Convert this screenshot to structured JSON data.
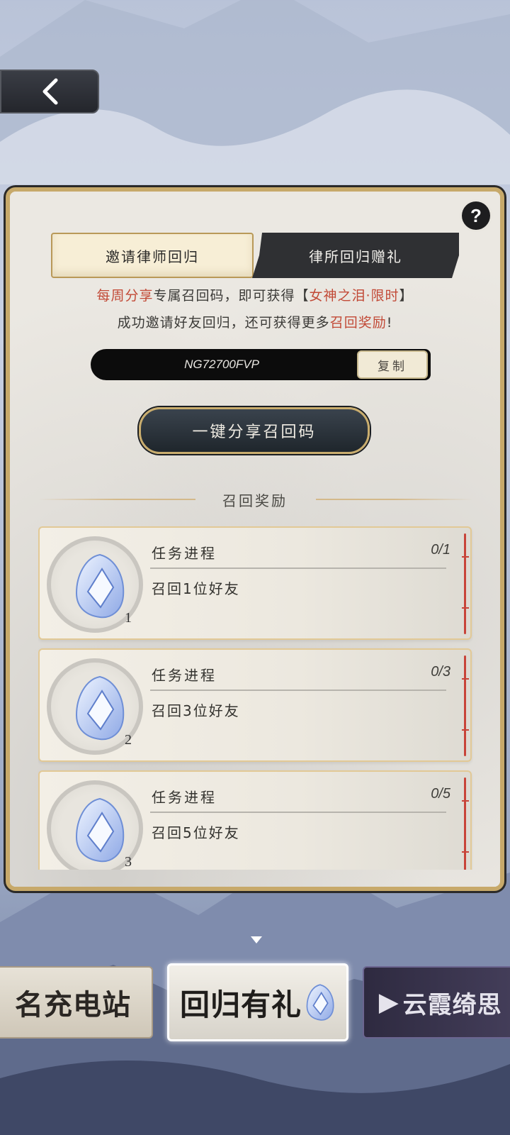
{
  "tabs": [
    {
      "label": "邀请律师回归",
      "active": true
    },
    {
      "label": "律所回归赠礼",
      "active": false
    }
  ],
  "description": {
    "line1_prefix": "每周分享",
    "line1_mid": "专属召回码，即可获得【",
    "line1_reward": "女神之泪·限时",
    "line1_suffix": "】",
    "line2_prefix": "成功邀请好友回归，还可获得更多",
    "line2_highlight": "召回奖励",
    "line2_suffix": "!"
  },
  "recall_code": {
    "value": "NG72700FVP",
    "copy_label": "复制"
  },
  "share_button": "一键分享召回码",
  "section_title": "召回奖励",
  "rewards": [
    {
      "task_label": "任务进程",
      "progress": "0/1",
      "desc": "召回1位好友",
      "count": "1"
    },
    {
      "task_label": "任务进程",
      "progress": "0/3",
      "desc": "召回3位好友",
      "count": "2"
    },
    {
      "task_label": "任务进程",
      "progress": "0/5",
      "desc": "召回5位好友",
      "count": "3"
    }
  ],
  "banners": {
    "left": "名充电站",
    "middle": "回归有礼",
    "right": "云霞绮思"
  },
  "colors": {
    "accent_red": "#c24a37",
    "gold_border": "#c7a96a",
    "dark_button": "#1f262c"
  },
  "icons": {
    "back": "chevron-left-icon",
    "help": "question-icon",
    "reward": "gem-icon"
  }
}
